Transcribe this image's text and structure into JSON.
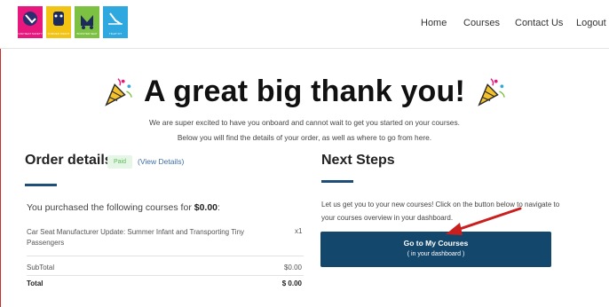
{
  "header": {
    "logos": [
      {
        "icon": "car-seat-icon",
        "bg": "#e8177d",
        "caption": "CAR SEAT SAFETY"
      },
      {
        "icon": "mascot-icon",
        "bg": "#f2c313",
        "caption": "SUMMER INFANT"
      },
      {
        "icon": "stroller-icon",
        "bg": "#7cc142",
        "caption": "BOOSTER SEAT"
      },
      {
        "icon": "harness-icon",
        "bg": "#2fa8e0",
        "caption": "TIGHT FIT"
      }
    ],
    "nav": [
      "Home",
      "Courses",
      "Contact Us",
      "Logout"
    ]
  },
  "hero": {
    "title": "A great big thank you!",
    "line1": "We are super excited to have you onboard and cannot wait to get you started on your courses.",
    "line2": "Below you will find the details of your order, as well as where to go from here."
  },
  "order": {
    "heading": "Order details",
    "status_badge": "Paid",
    "view_details": "(View Details)",
    "purchased_prefix": "You purchased the following courses for ",
    "purchased_amount": "$0.00",
    "purchased_suffix": ":",
    "course_name": "Car Seat Manufacturer Update: Summer Infant and Transporting Tiny Passengers",
    "course_qty": "x1",
    "subtotal_label": "SubTotal",
    "subtotal_value": "$0.00",
    "total_label": "Total",
    "total_value": "$ 0.00"
  },
  "next_steps": {
    "heading": "Next Steps",
    "text": "Let us get you to your new courses! Click on the button below to navigate to your courses overview in your dashboard.",
    "button_line1": "Go to My Courses",
    "button_line2": "( in your dashboard )"
  },
  "colors": {
    "accent": "#13476c",
    "paid_green": "#5cb85c",
    "arrow_red": "#c9201f"
  }
}
